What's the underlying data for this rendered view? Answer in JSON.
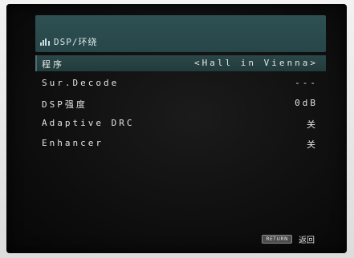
{
  "header": {
    "icon": "dsp-surround-icon",
    "title": "DSP/环绕"
  },
  "menu": {
    "items": [
      {
        "label": "程序",
        "value": "<Hall in Vienna>",
        "selected": true
      },
      {
        "label": "Sur.Decode",
        "value": "---",
        "selected": false
      },
      {
        "label": "DSP强度",
        "value": "0dB",
        "selected": false
      },
      {
        "label": "Adaptive DRC",
        "value": "关",
        "selected": false
      },
      {
        "label": "Enhancer",
        "value": "关",
        "selected": false
      }
    ]
  },
  "footer": {
    "return_key": "RETURN",
    "return_label": "返回"
  },
  "colors": {
    "header_bg": "#2f5052",
    "selected_row_bg": "#2b4747",
    "screen_bg": "#0c0c0c",
    "text": "#e3e3e3"
  }
}
